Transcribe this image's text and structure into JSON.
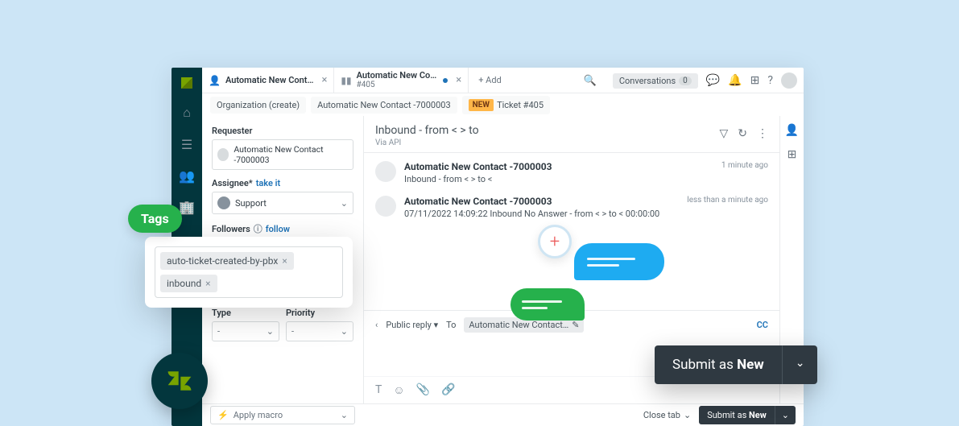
{
  "tabs": {
    "tab1": {
      "title": "Automatic New Cont…",
      "sub": ""
    },
    "tab2": {
      "title": "Automatic New Co…",
      "sub": "#405"
    },
    "add": "+ Add"
  },
  "topbar": {
    "conversations_label": "Conversations",
    "conversations_count": "0"
  },
  "breadcrumb": {
    "org": "Organization (create)",
    "contact": "Automatic New Contact -7000003",
    "badge": "NEW",
    "ticket": "Ticket #405"
  },
  "left": {
    "requester_label": "Requester",
    "requester_value": "Automatic New Contact -7000003",
    "assignee_label": "Assignee*",
    "assignee_value": "Support",
    "take_it": "take it",
    "followers_label": "Followers",
    "follow": "follow",
    "type_label": "Type",
    "priority_label": "Priority",
    "type_value": "-",
    "priority_value": "-"
  },
  "conversation": {
    "header_title": "Inbound - from <                > to",
    "via": "Via API",
    "msg1": {
      "name": "Automatic New Contact -7000003",
      "time": "1 minute ago",
      "body": "Inbound - from <              > to                        <"
    },
    "msg2": {
      "name": "Automatic New Contact -7000003",
      "time": "less than a minute ago",
      "body": "07/11/2022 14:09:22 Inbound No Answer - from <              > to               <                  00:00:00"
    }
  },
  "reply": {
    "public": "Public reply",
    "to_label": "To",
    "to_value": "Automatic New Contact…",
    "cc": "CC"
  },
  "bottom": {
    "macro": "Apply macro",
    "close_tab": "Close tab",
    "submit_prefix": "Submit as ",
    "submit_status": "New"
  },
  "overlay": {
    "tags_label": "Tags",
    "tag1": "auto-ticket-created-by-pbx",
    "tag2": "inbound",
    "big_submit_prefix": "Submit as ",
    "big_submit_status": "New"
  }
}
